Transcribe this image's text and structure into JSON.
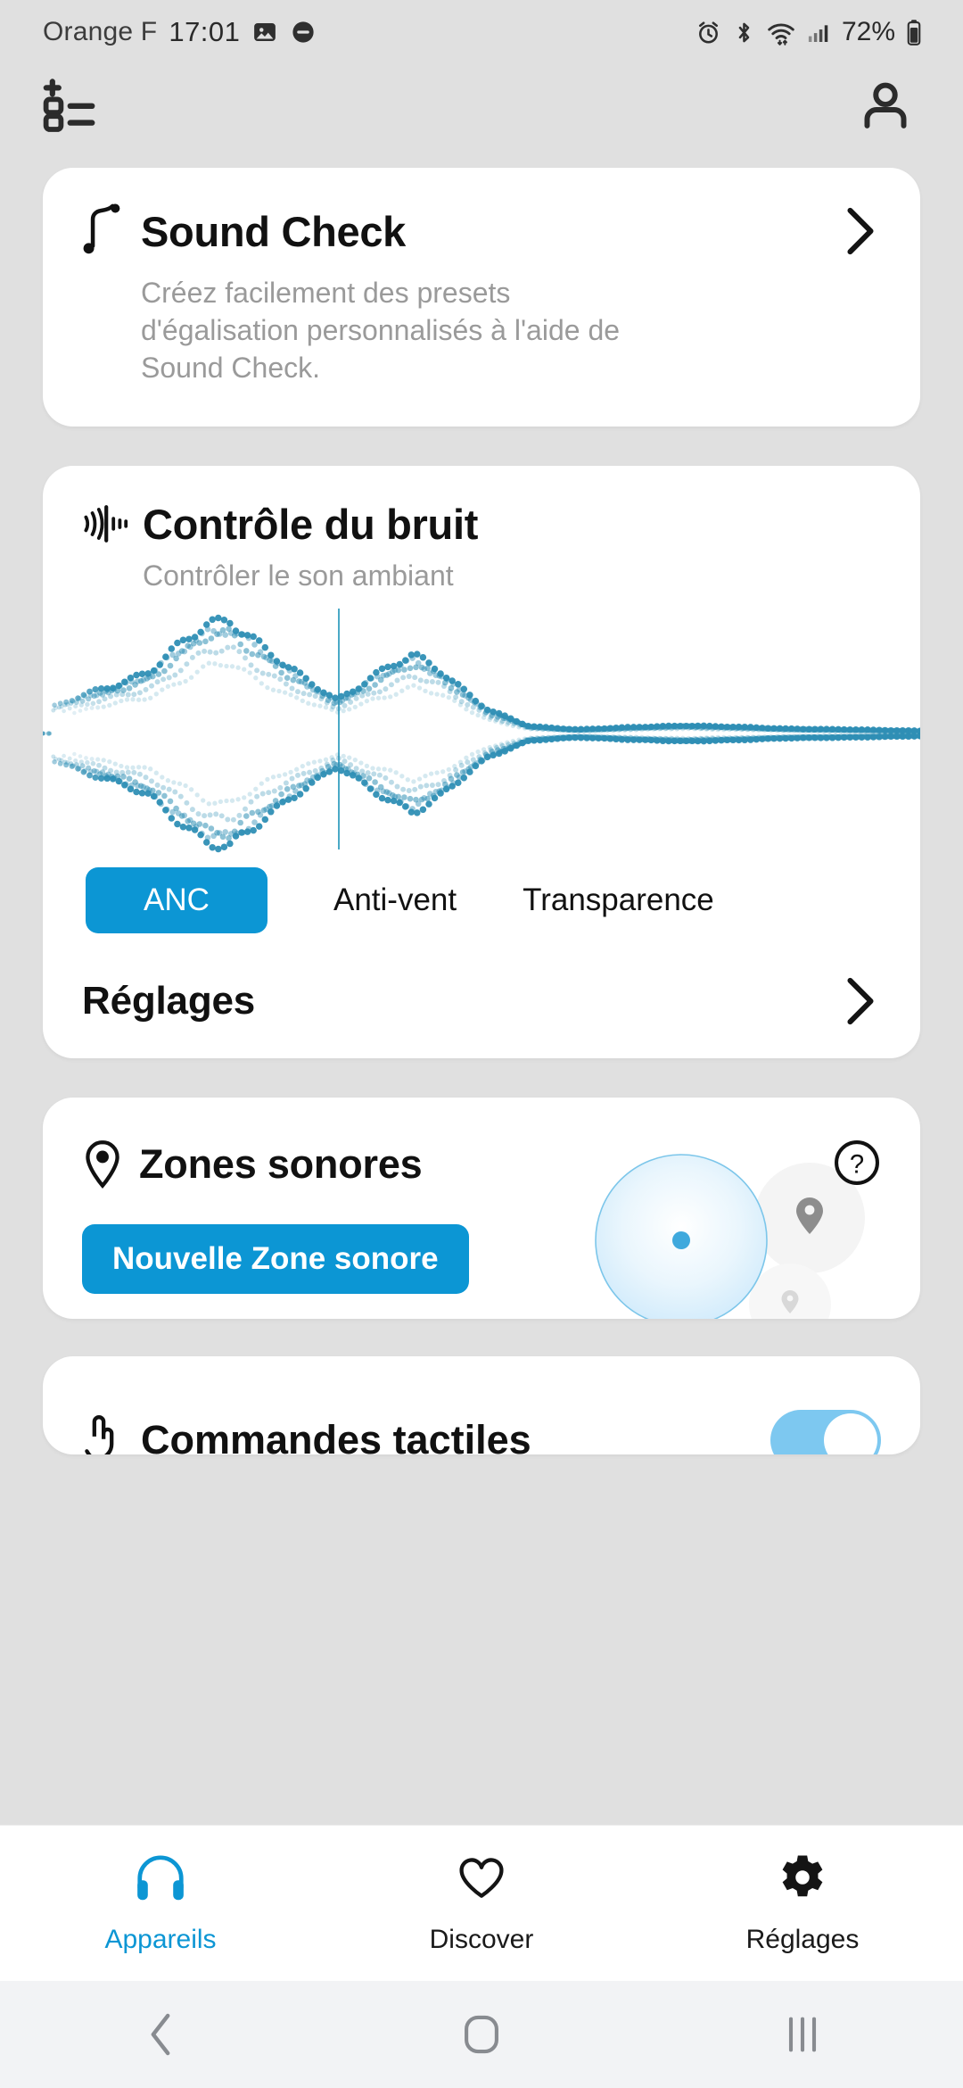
{
  "status_bar": {
    "carrier": "Orange F",
    "time": "17:01",
    "battery_percent": "72%",
    "icons": [
      "screenshot-icon",
      "dnd-icon",
      "alarm-icon",
      "bluetooth-icon",
      "wifi-icon",
      "signal-icon",
      "battery-icon"
    ]
  },
  "app_header": {
    "left_icon": "add-to-list-icon",
    "right_icon": "account-icon"
  },
  "sound_check": {
    "icon": "music-note-icon",
    "title": "Sound Check",
    "description": "Créez facilement des presets d'égalisation personnalisés à l'aide de Sound Check.",
    "chevron": "chevron-right-icon"
  },
  "noise_control": {
    "icon": "noise-wave-icon",
    "title": "Contrôle du bruit",
    "subtitle": "Contrôler le son ambiant",
    "modes": [
      {
        "id": "anc",
        "label": "ANC",
        "active": true
      },
      {
        "id": "antivent",
        "label": "Anti-vent",
        "active": false
      },
      {
        "id": "transparence",
        "label": "Transparence",
        "active": false
      }
    ],
    "settings_label": "Réglages",
    "settings_chevron": "chevron-right-icon",
    "accent_color": "#0c96d4",
    "waveform_color": "#2f8fb5"
  },
  "sound_zones": {
    "icon": "location-pin-icon",
    "title": "Zones sonores",
    "help_icon": "help-circle-icon",
    "new_zone_label": "Nouvelle Zone sonore",
    "accent_color": "#0c96d4"
  },
  "touch_controls": {
    "icon": "touch-icon",
    "title": "Commandes tactiles",
    "toggle_on": true
  },
  "tab_bar": {
    "tabs": [
      {
        "id": "appareils",
        "label": "Appareils",
        "icon": "headphones-icon",
        "active": true
      },
      {
        "id": "discover",
        "label": "Discover",
        "icon": "heart-icon",
        "active": false
      },
      {
        "id": "reglages",
        "label": "Réglages",
        "icon": "gear-icon",
        "active": false
      }
    ],
    "active_color": "#0c96d4"
  },
  "nav_bar": {
    "buttons": [
      {
        "id": "back",
        "icon": "back-chevron-icon"
      },
      {
        "id": "home",
        "icon": "home-square-icon"
      },
      {
        "id": "recents",
        "icon": "recents-bars-icon"
      }
    ]
  }
}
